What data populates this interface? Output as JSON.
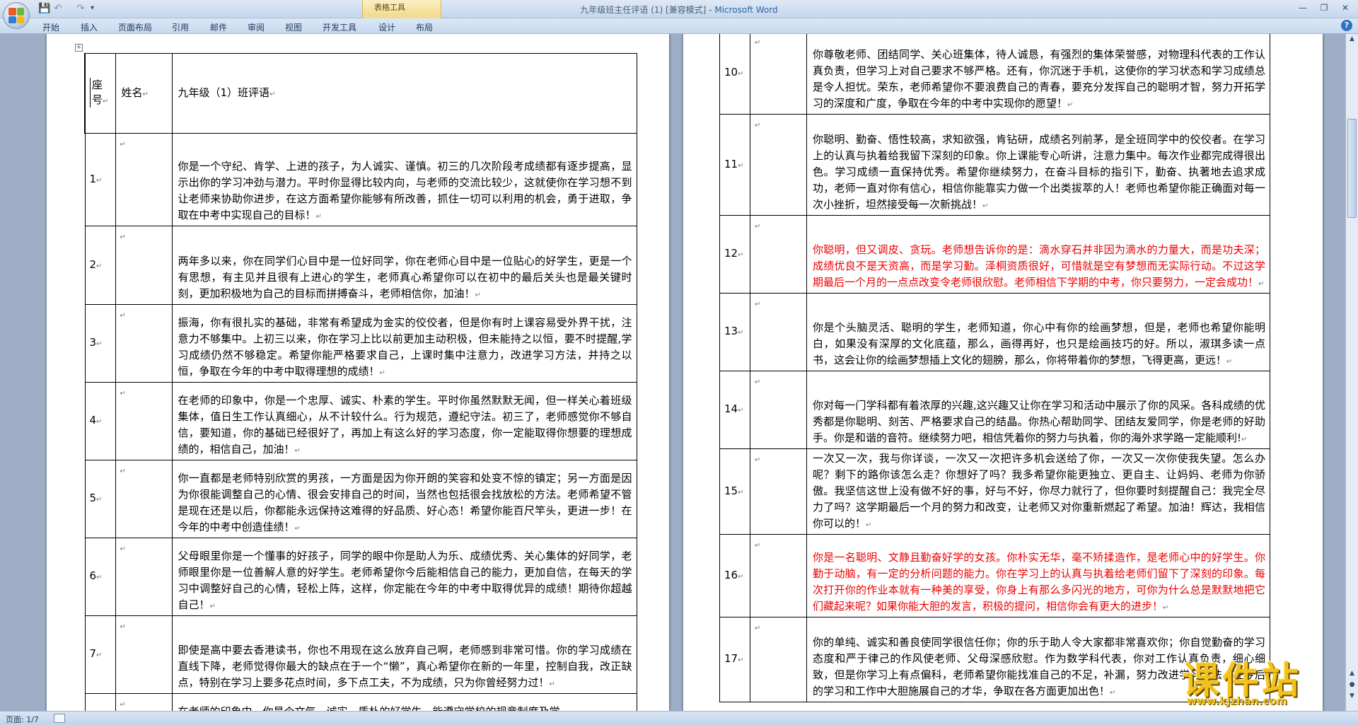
{
  "window": {
    "document_name": "九年级班主任评语 (1) [兼容模式]",
    "app_name": "Microsoft Word",
    "title_separator": " - "
  },
  "ribbon": {
    "contextual_group": "表格工具",
    "tabs": [
      "开始",
      "插入",
      "页面布局",
      "引用",
      "邮件",
      "审阅",
      "视图",
      "开发工具",
      "设计",
      "布局"
    ]
  },
  "table": {
    "headers": {
      "number": "座号",
      "name": "姓名",
      "comment": "九年级（1）班评语"
    },
    "left_rows": [
      {
        "num": "1",
        "text": "你是一个守纪、肯学、上进的孩子，为人诚实、谨慎。初三的几次阶段考成绩都有逐步提高，显示出你的学习冲劲与潜力。平时你显得比较内向，与老师的交流比较少，这就使你在学习想不到让老师来协助你进步，在这方面希望你能够有所改善，抓住一切可以利用的机会，勇于进取，争取在中考中实现自己的目标！"
      },
      {
        "num": "2",
        "text": "两年多以来，你在同学们心目中是一位好同学，你在老师心目中是一位贴心的好学生，更是一个有思想，有主见并且很有上进心的学生，老师真心希望你可以在初中的最后关头也是最关键时刻，更加积极地为自己的目标而拼搏奋斗，老师相信你，加油！"
      },
      {
        "num": "3",
        "text": "振海，你有很扎实的基础，非常有希望成为金实的佼佼者，但是你有时上课容易受外界干扰，注意力不够集中。上初三以来，你在学习上比以前更加主动积极，但未能持之以恒，要不时提醒,学习成绩仍然不够稳定。希望你能严格要求自己，上课时集中注意力，改进学习方法，并持之以恒，争取在今年的中考中取得理想的成绩！"
      },
      {
        "num": "4",
        "text": "在老师的印象中，你是一个忠厚、诚实、朴素的学生。平时你虽然默默无闻，但一样关心着班级集体，值日生工作认真细心，从不计较什么。行为规范，遵纪守法。初三了，老师感觉你不够自信，要知道，你的基础已经很好了，再加上有这么好的学习态度，你一定能取得你想要的理想成绩的，相信自己，加油！"
      },
      {
        "num": "5",
        "text": "你一直都是老师特别欣赏的男孩，一方面是因为你开朗的笑容和处变不惊的镇定；另一方面是因为你很能调整自己的心情、很会安排自己的时间，当然也包括很会找放松的方法。老师希望不管是现在还是以后，你都能永远保持这难得的好品质、好心态！希望你能百尺竿头，更进一步！在今年的中考中创造佳绩！"
      },
      {
        "num": "6",
        "text": "父母眼里你是一个懂事的好孩子，同学的眼中你是助人为乐、成绩优秀、关心集体的好同学，老师眼里你是一位善解人意的好学生。老师希望你今后能相信自己的能力，更加自信，在每天的学习中调整好自己的心情，轻松上阵，这样，你定能在今年的中考中取得优异的成绩！期待你超越自己！"
      },
      {
        "num": "7",
        "text": "即使是高中要去香港读书，你也不用现在这么放弃自己啊，老师感到非常可惜。你的学习成绩在直线下降，老师觉得你最大的缺点在于一个“懒”，真心希望你在新的一年里，控制自我，改正缺点，特别在学习上要多花点时间，多下点工夫，不为成绩，只为你曾经努力过！"
      },
      {
        "num": "",
        "text": "在老师的印象中，你是个文气、诚实、质朴的好学生，能遵守学校的规章制度及学"
      }
    ],
    "right_rows": [
      {
        "num": "10",
        "text": "你尊敬老师、团结同学、关心班集体，待人诚恳，有强烈的集体荣誉感，对物理科代表的工作认真负责，但学习上对自己要求不够严格。还有，你沉迷于手机，这使你的学习状态和学习成绩总是令人担忧。荣东，老师希望你不要浪费自己的青春，要充分发挥自己的聪明才智，努力开拓学习的深度和广度，争取在今年的中考中实现你的愿望！",
        "red": false
      },
      {
        "num": "11",
        "text": "你聪明、勤奋、悟性较高，求知欲强，肯钻研，成绩名列前茅，是全班同学中的佼佼者。在学习上的认真与执着给我留下深刻的印象。你上课能专心听讲，注意力集中。每次作业都完成得很出色。学习成绩一直保持优秀。希望你继续努力，在奋斗目标的指引下，勤奋、执著地去追求成功，老师一直对你有信心，相信你能靠实力做一个出类拔萃的人！老师也希望你能正确面对每一次小挫折，坦然接受每一次新挑战！",
        "red": false
      },
      {
        "num": "12",
        "text": "你聪明，但又调皮、贪玩。老师想告诉你的是：滴水穿石并非因为滴水的力量大，而是功夫深；成绩优良不是天资高，而是学习勤。泽桐资质很好，可惜就是空有梦想而无实际行动。不过这学期最后一个月的一点点改变令老师很欣慰。老师相信下学期的中考，你只要努力，一定会成功！",
        "red": true
      },
      {
        "num": "13",
        "text": "你是个头脑灵活、聪明的学生，老师知道，你心中有你的绘画梦想，但是，老师也希望你能明白，如果没有深厚的文化底蕴，那么，画得再好，也只是绘画技巧的好。所以，淑琪多读一点书，这会让你的绘画梦想插上文化的翅膀，那么，你将带着你的梦想，飞得更高，更远！",
        "red": false
      },
      {
        "num": "14",
        "text": "你对每一门学科都有着浓厚的兴趣,这兴趣又让你在学习和活动中展示了你的风采。各科成绩的优秀都是你聪明、刻苦、严格要求自己的结晶。你热心帮助同学、团结友爱同学，你是老师的好助手。你是和谐的音符。继续努力吧，相信凭着你的努力与执着，你的海外求学路一定能顺利!",
        "red": false
      },
      {
        "num": "15",
        "text": "一次又一次，我与你详谈，一次又一次把许多机会送给了你，一次又一次你使我失望。怎么办呢？剩下的路你该怎么走？你想好了吗？我多希望你能更独立、更自主、让妈妈、老师为你骄傲。我坚信这世上没有做不好的事，好与不好，你尽力就行了，但你要时刻提醒自己：我完全尽力了吗？这学期最后一个月的努力和改变，让老师又对你重新燃起了希望。加油！辉达，我相信你可以的！",
        "red": false
      },
      {
        "num": "16",
        "text": "你是一名聪明、文静且勤奋好学的女孩。你朴实无华，毫不矫揉造作，是老师心中的好学生。你勤于动脑，有一定的分析问题的能力。你在学习上的认真与执着给老师们留下了深刻的印象。每次打开你的作业本就有一种美的享受，你身上有那么多闪光的地方，可你为什么总是默默地把它们藏起来呢？如果你能大胆的发言，积极的提问，相信你会有更大的进步！",
        "red": true
      },
      {
        "num": "17",
        "text": "你的单纯、诚实和善良使同学很信任你；你的乐于助人令大家都非常喜欢你；你自觉勤奋的学习态度和严于律己的作风使老师、父母深感欣慰。作为数学科代表，你对工作认真负责，细心细致，但是你学习上有点偏科，老师希望你能找准自己的不足，补漏，努力改进学习方法，在今后的学习和工作中大胆施展自己的才华，争取在各方面更加出色！",
        "red": false
      }
    ]
  },
  "status": {
    "page": "页面: 1/7"
  },
  "watermark": {
    "main": "课件站",
    "url": "www.kjzhan.com"
  }
}
